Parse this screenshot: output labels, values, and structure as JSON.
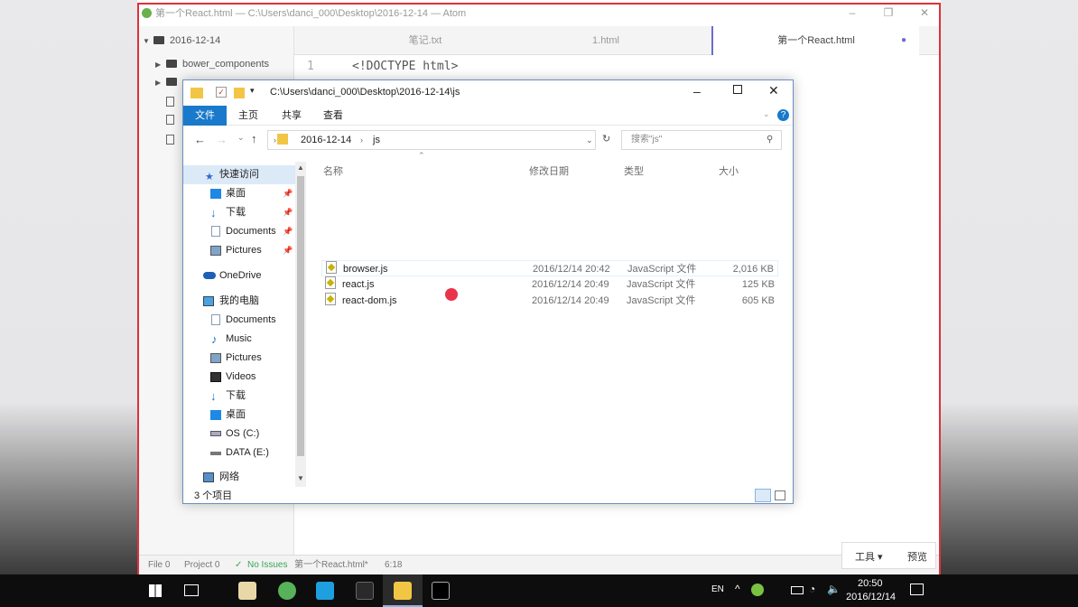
{
  "atom": {
    "title": "第一个React.html — C:\\Users\\danci_000\\Desktop\\2016-12-14 — Atom",
    "tree": {
      "root": "2016-12-14",
      "items": [
        "bower_components",
        ""
      ]
    },
    "tabs": [
      "笔记.txt",
      "1.html",
      "第一个React.html"
    ],
    "editor": {
      "line_number": "1",
      "line_text": "<!DOCTYPE html>"
    },
    "status": {
      "file": "File 0",
      "project": "Project 0",
      "issues": "No Issues",
      "filename": "第一个React.html*",
      "cursor": "6:18"
    },
    "tools": {
      "tools_label": "工具",
      "preview_label": "预览"
    }
  },
  "explorer": {
    "path_title": "C:\\Users\\danci_000\\Desktop\\2016-12-14\\js",
    "ribbon": {
      "file": "文件",
      "home": "主页",
      "share": "共享",
      "view": "查看"
    },
    "breadcrumb": {
      "part1": "2016-12-14",
      "part2": "js"
    },
    "search_placeholder": "搜索\"js\"",
    "columns": {
      "name": "名称",
      "date": "修改日期",
      "type": "类型",
      "size": "大小"
    },
    "files": [
      {
        "name": "browser.js",
        "date": "2016/12/14 20:42",
        "type": "JavaScript 文件",
        "size": "2,016 KB"
      },
      {
        "name": "react.js",
        "date": "2016/12/14 20:49",
        "type": "JavaScript 文件",
        "size": "125 KB"
      },
      {
        "name": "react-dom.js",
        "date": "2016/12/14 20:49",
        "type": "JavaScript 文件",
        "size": "605 KB"
      }
    ],
    "nav": {
      "quick_access": "快速访问",
      "qa_desktop": "桌面",
      "qa_downloads": "下载",
      "qa_documents": "Documents",
      "qa_pictures": "Pictures",
      "onedrive": "OneDrive",
      "this_pc": "我的电脑",
      "pc_documents": "Documents",
      "pc_music": "Music",
      "pc_pictures": "Pictures",
      "pc_videos": "Videos",
      "pc_downloads": "下载",
      "pc_desktop": "桌面",
      "os_drive": "OS (C:)",
      "data_drive": "DATA (E:)",
      "network": "网络"
    },
    "item_count": "3 个项目"
  },
  "taskbar": {
    "lang": "EN",
    "time": "20:50",
    "date": "2016/12/14"
  },
  "colors": {
    "ribbon_file_tab": "#1979ca",
    "window_border": "#e0303a",
    "cursor_dot": "#e8334a"
  }
}
